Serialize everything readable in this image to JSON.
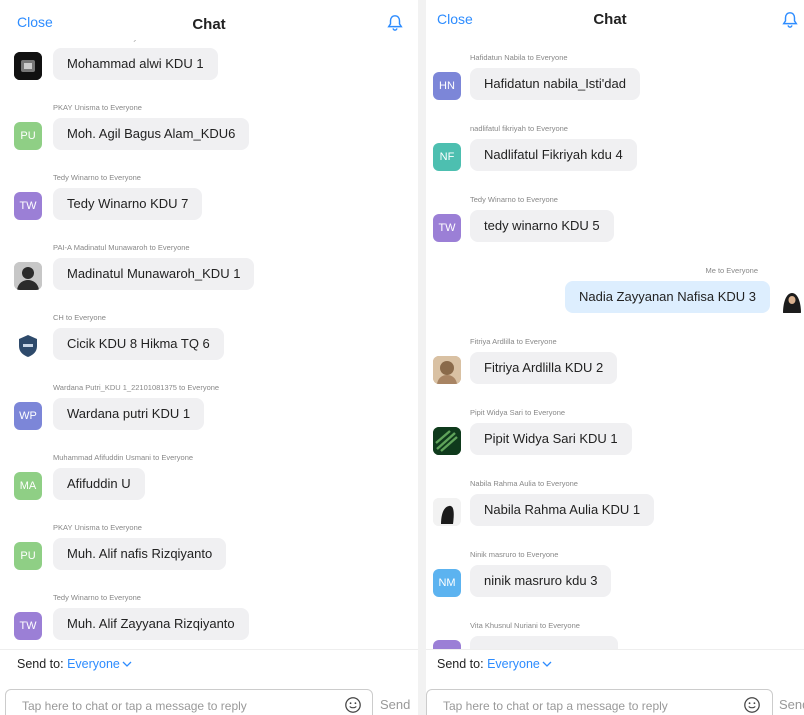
{
  "left": {
    "close_label": "Close",
    "title": "Chat",
    "messages": [
      {
        "sender": "Mohammad alwi to Everyone",
        "text": "Mohammad alwi KDU 1",
        "avatar": "",
        "avatar_color": "#111111",
        "type": "photo-dark"
      },
      {
        "sender": "PKAY Unisma to Everyone",
        "text": "Moh. Agil Bagus Alam_KDU6",
        "avatar": "PU",
        "avatar_color": "#8fcf85",
        "type": "initials"
      },
      {
        "sender": "Tedy Winarno to Everyone",
        "text": "Tedy Winarno KDU 7",
        "avatar": "TW",
        "avatar_color": "#9b7fd6",
        "type": "initials"
      },
      {
        "sender": "PAI-A Madinatul Munawaroh to Everyone",
        "text": "Madinatul Munawaroh_KDU 1",
        "avatar": "",
        "avatar_color": "#bfbfbf",
        "type": "photo-person"
      },
      {
        "sender": "CH to Everyone",
        "text": "Cicik KDU 8 Hikma TQ 6",
        "avatar": "",
        "avatar_color": "#ffffff",
        "type": "photo-shield"
      },
      {
        "sender": "Wardana Putri_KDU 1_22101081375 to Everyone",
        "text": "Wardana putri KDU 1",
        "avatar": "WP",
        "avatar_color": "#7c86d8",
        "type": "initials"
      },
      {
        "sender": "Muhammad Afifuddin Usmani to Everyone",
        "text": "Afifuddin U",
        "avatar": "MA",
        "avatar_color": "#8fcf85",
        "type": "initials"
      },
      {
        "sender": "PKAY Unisma to Everyone",
        "text": "Muh. Alif nafis Rizqiyanto",
        "avatar": "PU",
        "avatar_color": "#8fcf85",
        "type": "initials"
      },
      {
        "sender": "Tedy Winarno to Everyone",
        "text": "Muh. Alif Zayyana Rizqiyanto",
        "avatar": "TW",
        "avatar_color": "#9b7fd6",
        "type": "initials"
      }
    ],
    "send_to_label": "Send to:",
    "send_to_value": "Everyone",
    "input_placeholder": "Tap here to chat or tap a message to reply",
    "send_label": "Send"
  },
  "right": {
    "close_label": "Close",
    "title": "Chat",
    "messages": [
      {
        "sender": "Hafidatun Nabila to Everyone",
        "text": "Hafidatun nabila_Isti'dad",
        "avatar": "HN",
        "avatar_color": "#7c86d8",
        "type": "initials"
      },
      {
        "sender": "nadlifatul fikriyah to Everyone",
        "text": "Nadlifatul Fikriyah kdu 4",
        "avatar": "NF",
        "avatar_color": "#4dbfb0",
        "type": "initials"
      },
      {
        "sender": "Tedy Winarno to Everyone",
        "text": "tedy winarno KDU 5",
        "avatar": "TW",
        "avatar_color": "#9b7fd6",
        "type": "initials"
      },
      {
        "sender": "Me to Everyone",
        "text": "Nadia Zayyanan Nafisa KDU 3",
        "avatar": "",
        "avatar_color": "#ffffff",
        "type": "me"
      },
      {
        "sender": "Fitriya Ardlilla to Everyone",
        "text": "Fitriya Ardlilla KDU 2",
        "avatar": "",
        "avatar_color": "#c9a27a",
        "type": "photo-beige"
      },
      {
        "sender": "Pipit Widya Sari to Everyone",
        "text": "Pipit Widya Sari KDU 1",
        "avatar": "",
        "avatar_color": "#1f5a2c",
        "type": "photo-green"
      },
      {
        "sender": "Nabila Rahma Aulia to Everyone",
        "text": "Nabila Rahma Aulia KDU 1",
        "avatar": "",
        "avatar_color": "#eeeeee",
        "type": "photo-hijab"
      },
      {
        "sender": "Ninik masruro to Everyone",
        "text": "ninik masruro kdu 3",
        "avatar": "NM",
        "avatar_color": "#5cb3f0",
        "type": "initials"
      },
      {
        "sender": "Vita Khusnul Nuriani to Everyone",
        "text": "",
        "avatar": "",
        "avatar_color": "#9b7fd6",
        "type": "initials"
      }
    ],
    "send_to_label": "Send to:",
    "send_to_value": "Everyone",
    "input_placeholder": "Tap here to chat or tap a message to reply",
    "send_label": "Send"
  },
  "colors": {
    "accent": "#2d8cff",
    "bubble": "#f0f0f2",
    "bubble_me": "#ddeefe"
  }
}
